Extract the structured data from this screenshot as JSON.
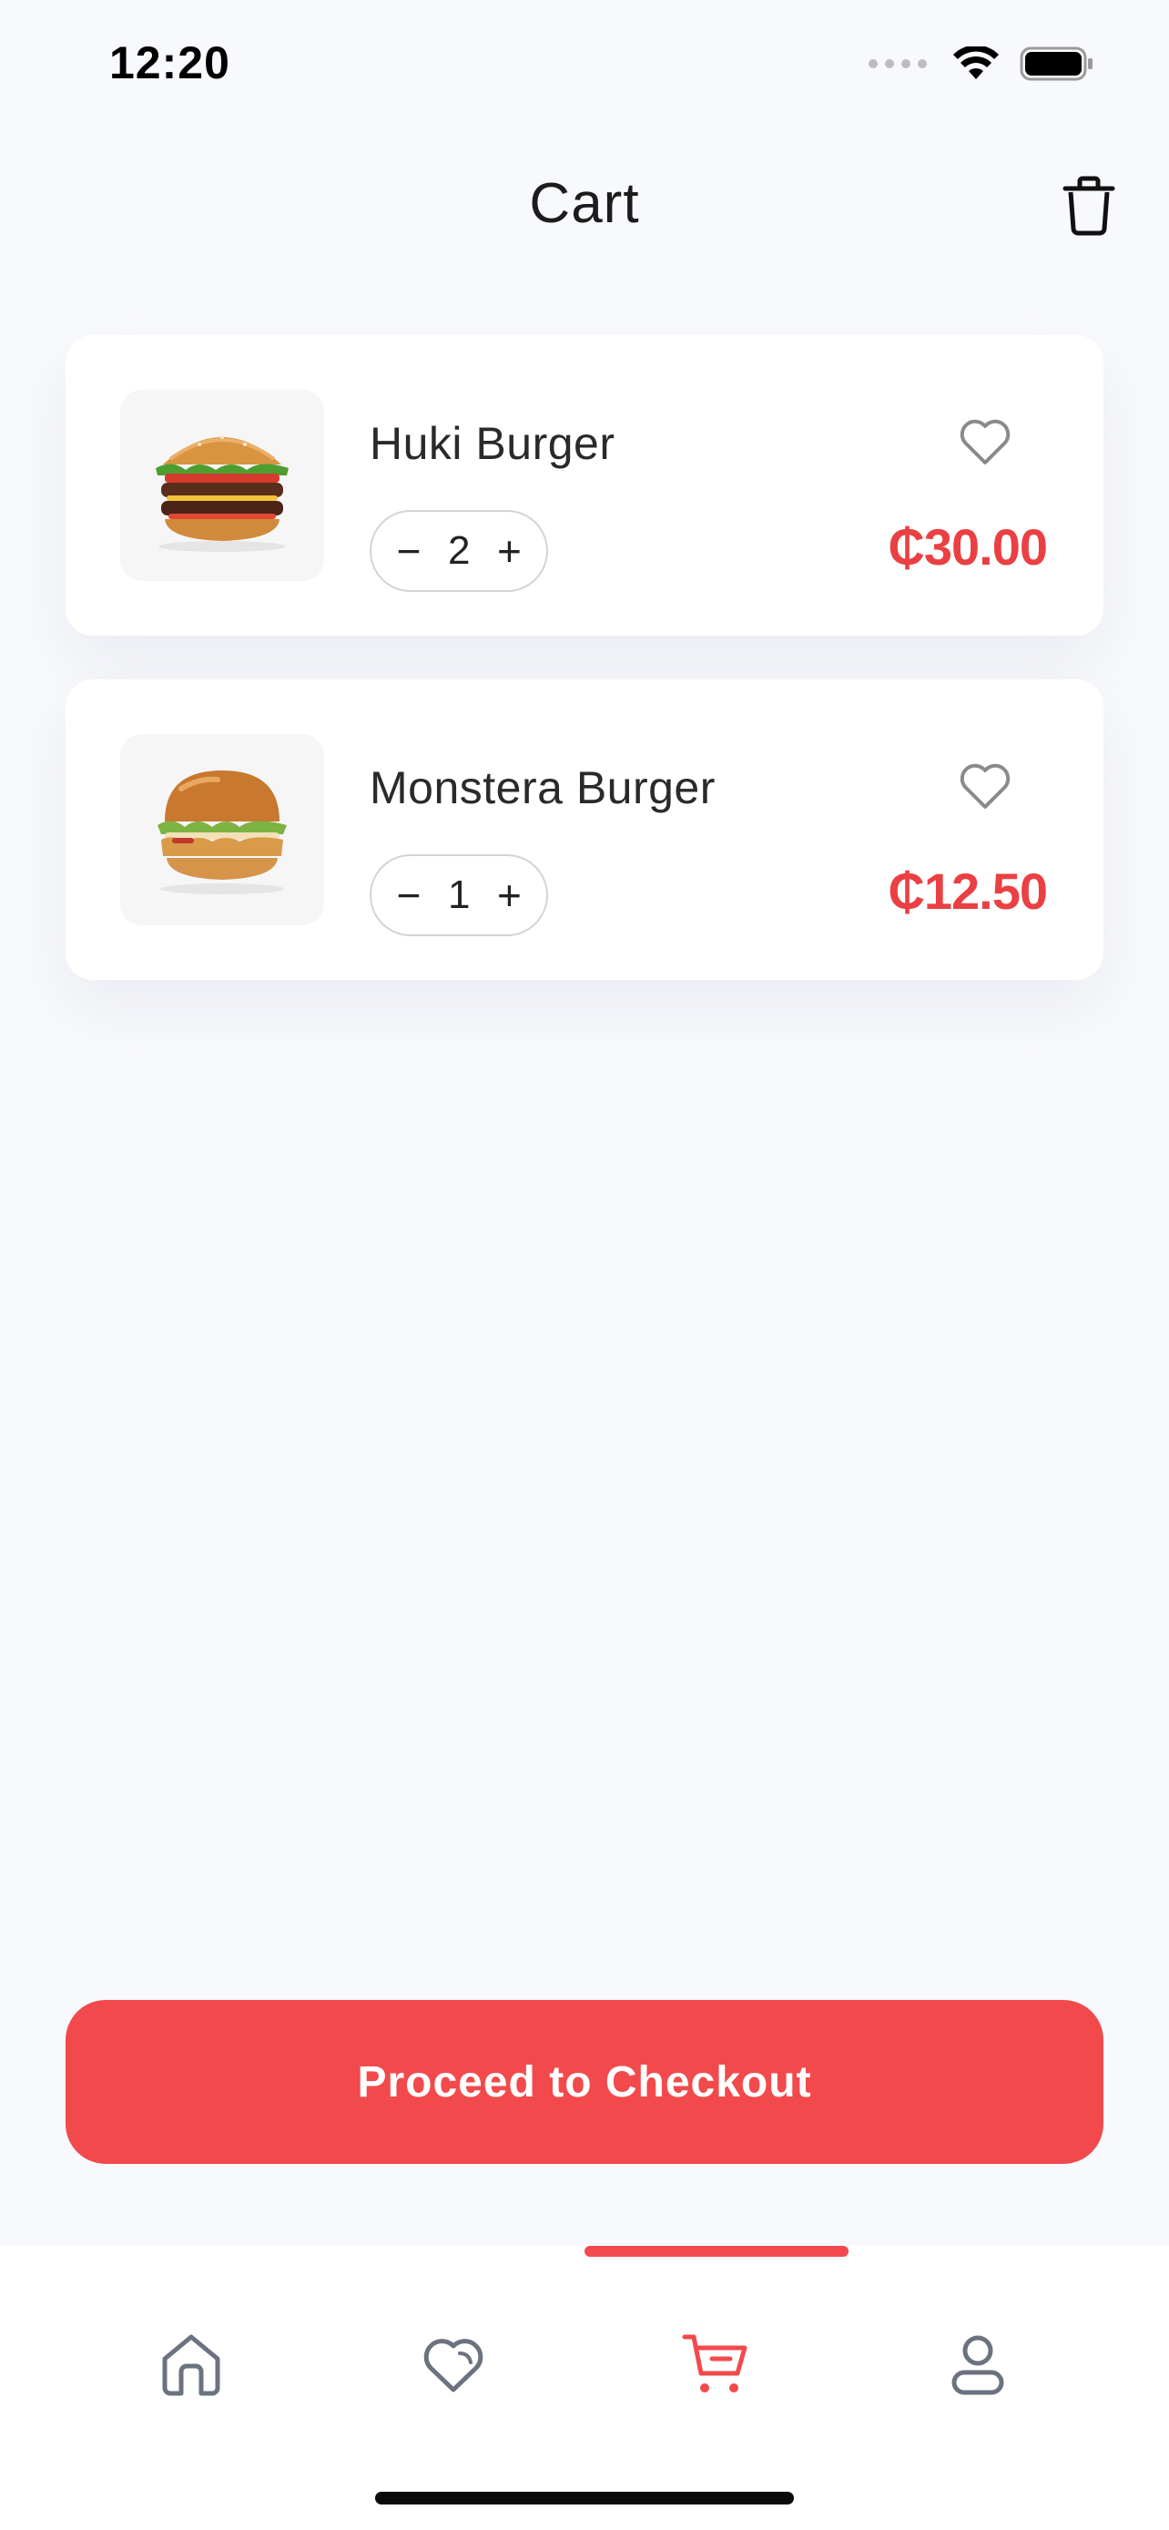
{
  "status_bar": {
    "time": "12:20",
    "icons": [
      "cellular-signal-icon",
      "wifi-icon",
      "battery-icon"
    ]
  },
  "header": {
    "title": "Cart",
    "action_icon": "trash-icon"
  },
  "cart": {
    "items": [
      {
        "name": "Huki Burger",
        "quantity": "2",
        "price": "₵30.00",
        "image_icon": "burger-double-icon",
        "favorite_icon": "heart-outline-icon"
      },
      {
        "name": "Monstera Burger",
        "quantity": "1",
        "price": "₵12.50",
        "image_icon": "burger-chicken-icon",
        "favorite_icon": "heart-outline-icon"
      }
    ],
    "decrement_symbol": "−",
    "increment_symbol": "+"
  },
  "checkout": {
    "label": "Proceed to Checkout"
  },
  "tab_bar": {
    "tabs": [
      {
        "icon": "home-icon",
        "active": false
      },
      {
        "icon": "heart-icon",
        "active": false
      },
      {
        "icon": "cart-icon",
        "active": true
      },
      {
        "icon": "profile-icon",
        "active": false
      }
    ]
  },
  "colors": {
    "accent": "#f24a4c",
    "price": "#ea4043",
    "background": "#f8f9fc",
    "card": "#ffffff",
    "inactive_icon": "#6b7280"
  }
}
